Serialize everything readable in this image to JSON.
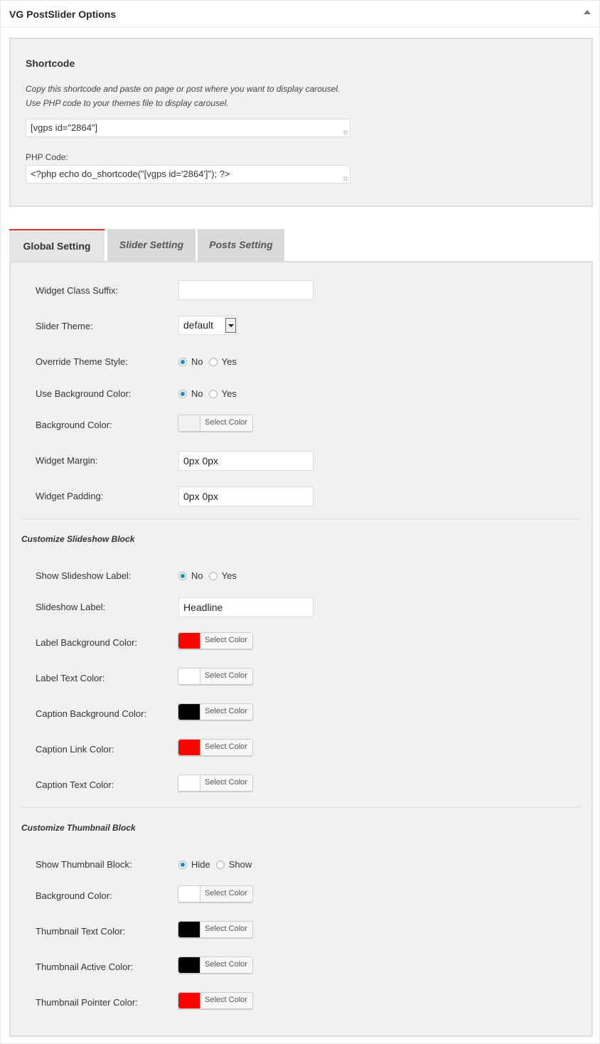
{
  "metabox": {
    "title": "VG PostSlider Options"
  },
  "shortcode": {
    "heading": "Shortcode",
    "desc_line1": "Copy this shortcode and paste on page or post where you want to display carousel.",
    "desc_line2": "Use PHP code to your themes file to display carousel.",
    "shortcode_value": "[vgps id=\"2864\"]",
    "php_label": "PHP Code:",
    "php_value": "<?php echo do_shortcode(\"[vgps id='2864']\"); ?>"
  },
  "tabs": [
    {
      "label": "Global Setting",
      "active": true
    },
    {
      "label": "Slider Setting",
      "active": false
    },
    {
      "label": "Posts Setting",
      "active": false
    }
  ],
  "select_color_label": "Select Color",
  "global": {
    "widget_class_suffix": {
      "label": "Widget Class Suffix:",
      "value": ""
    },
    "slider_theme": {
      "label": "Slider Theme:",
      "value": "default"
    },
    "override_theme_style": {
      "label": "Override Theme Style:",
      "opt1": "No",
      "opt2": "Yes",
      "selected": "No"
    },
    "use_background_color": {
      "label": "Use Background Color:",
      "opt1": "No",
      "opt2": "Yes",
      "selected": "No"
    },
    "background_color": {
      "label": "Background Color:",
      "color": "#f1f1f1"
    },
    "widget_margin": {
      "label": "Widget Margin:",
      "value": "0px 0px"
    },
    "widget_padding": {
      "label": "Widget Padding:",
      "value": "0px 0px"
    }
  },
  "slideshow": {
    "section_title": "Customize Slideshow Block",
    "show_label": {
      "label": "Show Slideshow Label:",
      "opt1": "No",
      "opt2": "Yes",
      "selected": "No"
    },
    "slideshow_label": {
      "label": "Slideshow Label:",
      "value": "Headline"
    },
    "label_bg_color": {
      "label": "Label Background Color:",
      "color": "#ff0000"
    },
    "label_text_color": {
      "label": "Label Text Color:",
      "color": "#ffffff"
    },
    "caption_bg_color": {
      "label": "Caption Background Color:",
      "color": "#000000"
    },
    "caption_link_color": {
      "label": "Caption Link Color:",
      "color": "#ff0000"
    },
    "caption_text_color": {
      "label": "Caption Text Color:",
      "color": "#ffffff"
    }
  },
  "thumbnail": {
    "section_title": "Customize Thumbnail Block",
    "show_block": {
      "label": "Show Thumbnail Block:",
      "opt1": "Hide",
      "opt2": "Show",
      "selected": "Hide"
    },
    "background_color": {
      "label": "Background Color:",
      "color": "#ffffff"
    },
    "text_color": {
      "label": "Thumbnail Text Color:",
      "color": "#000000"
    },
    "active_color": {
      "label": "Thumbnail Active Color:",
      "color": "#000000"
    },
    "pointer_color": {
      "label": "Thumbnail Pointer Color:",
      "color": "#ff0000"
    }
  }
}
